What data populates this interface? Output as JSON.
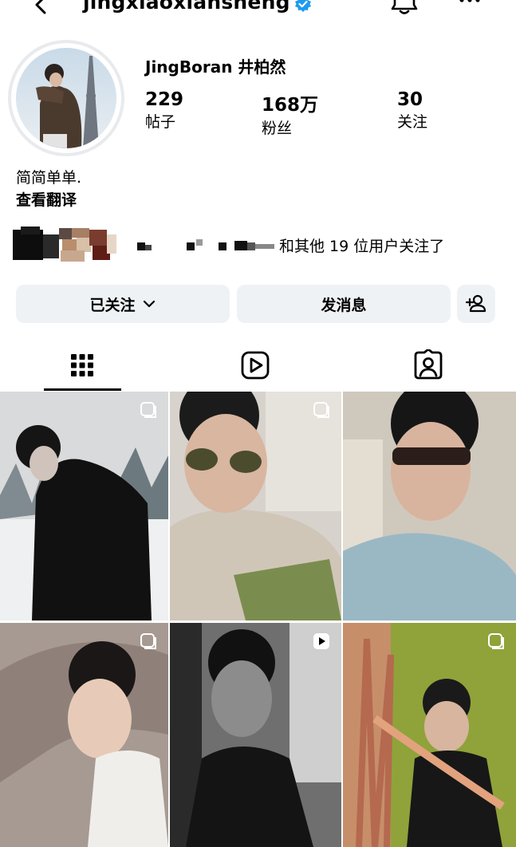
{
  "header": {
    "username": "jingxiaoxiansheng"
  },
  "profile": {
    "display_name": "JingBoran 井柏然",
    "stats": [
      {
        "value": "229",
        "label": "帖子"
      },
      {
        "value": "168万",
        "label": "粉丝"
      },
      {
        "value": "30",
        "label": "关注"
      }
    ],
    "bio": "简简单单.",
    "translate_link": "查看翻译",
    "followed_by_text": "和其他 19 位用户关注了"
  },
  "actions": {
    "following_label": "已关注",
    "message_label": "发消息"
  },
  "colors": {
    "verified": "#1d9bf0",
    "button_bg": "#eff2f5"
  },
  "tabs": [
    {
      "icon": "grid-icon",
      "active": true
    },
    {
      "icon": "reels-icon",
      "active": false
    },
    {
      "icon": "tagged-icon",
      "active": false
    }
  ],
  "grid_badges": [
    "carousel",
    "carousel",
    "none",
    "carousel",
    "reel",
    "carousel"
  ]
}
